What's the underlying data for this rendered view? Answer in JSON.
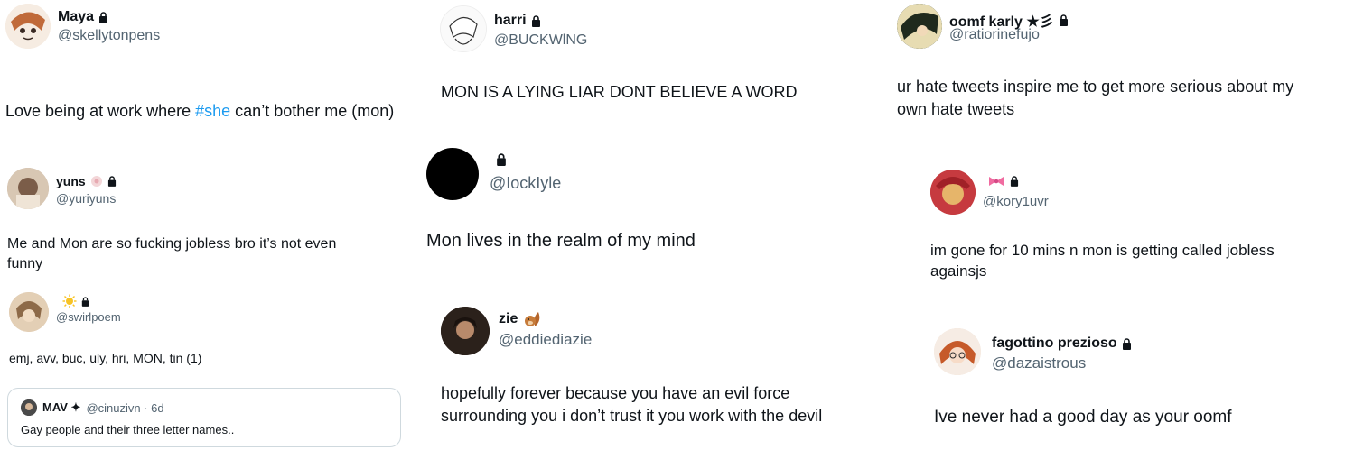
{
  "colors": {
    "text": "#0f1419",
    "muted": "#536471",
    "link": "#1d9bf0",
    "border": "#cfd9de"
  },
  "tweets": [
    {
      "name": "Maya",
      "handle": "@skellytonpens",
      "text_before": "Love being at work where ",
      "hashtag": "#she",
      "text_after": " can’t bother me (mon)"
    },
    {
      "name": "harri",
      "handle": "@BUCKWlNG",
      "text": "MON IS A LYING LIAR DONT BELIEVE A WORD"
    },
    {
      "name": "oomf karly ★彡",
      "handle": "@ratiorinefujo",
      "text": "ur hate tweets inspire me to get more serious about my\nown hate tweets"
    },
    {
      "name": "yuns",
      "handle": "@yuriyuns",
      "text": "Me and Mon are so fucking jobless bro it’s not even\nfunny"
    },
    {
      "name": "",
      "handle": "@IockIyle",
      "text": "Mon lives in the realm of my mind"
    },
    {
      "name": "",
      "handle": "@kory1uvr",
      "text": "im gone for 10 mins n mon is getting called jobless\nagainsjs"
    },
    {
      "name": "",
      "handle": "@swirlpoem",
      "text": "emj, avv, buc, uly, hri, MON, tin (1)",
      "quote": {
        "name": "MAV ✦",
        "handle": "@cinuzivn · 6d",
        "text": "Gay people and their three letter names.."
      }
    },
    {
      "name": "zie",
      "handle": "@eddiediazie",
      "text": "hopefully forever because you have an evil force\nsurrounding you i don’t trust it you work with the devil"
    },
    {
      "name": "fagottino prezioso",
      "handle": "@dazaistrous",
      "text": "Ive never had a good day as your oomf"
    }
  ]
}
